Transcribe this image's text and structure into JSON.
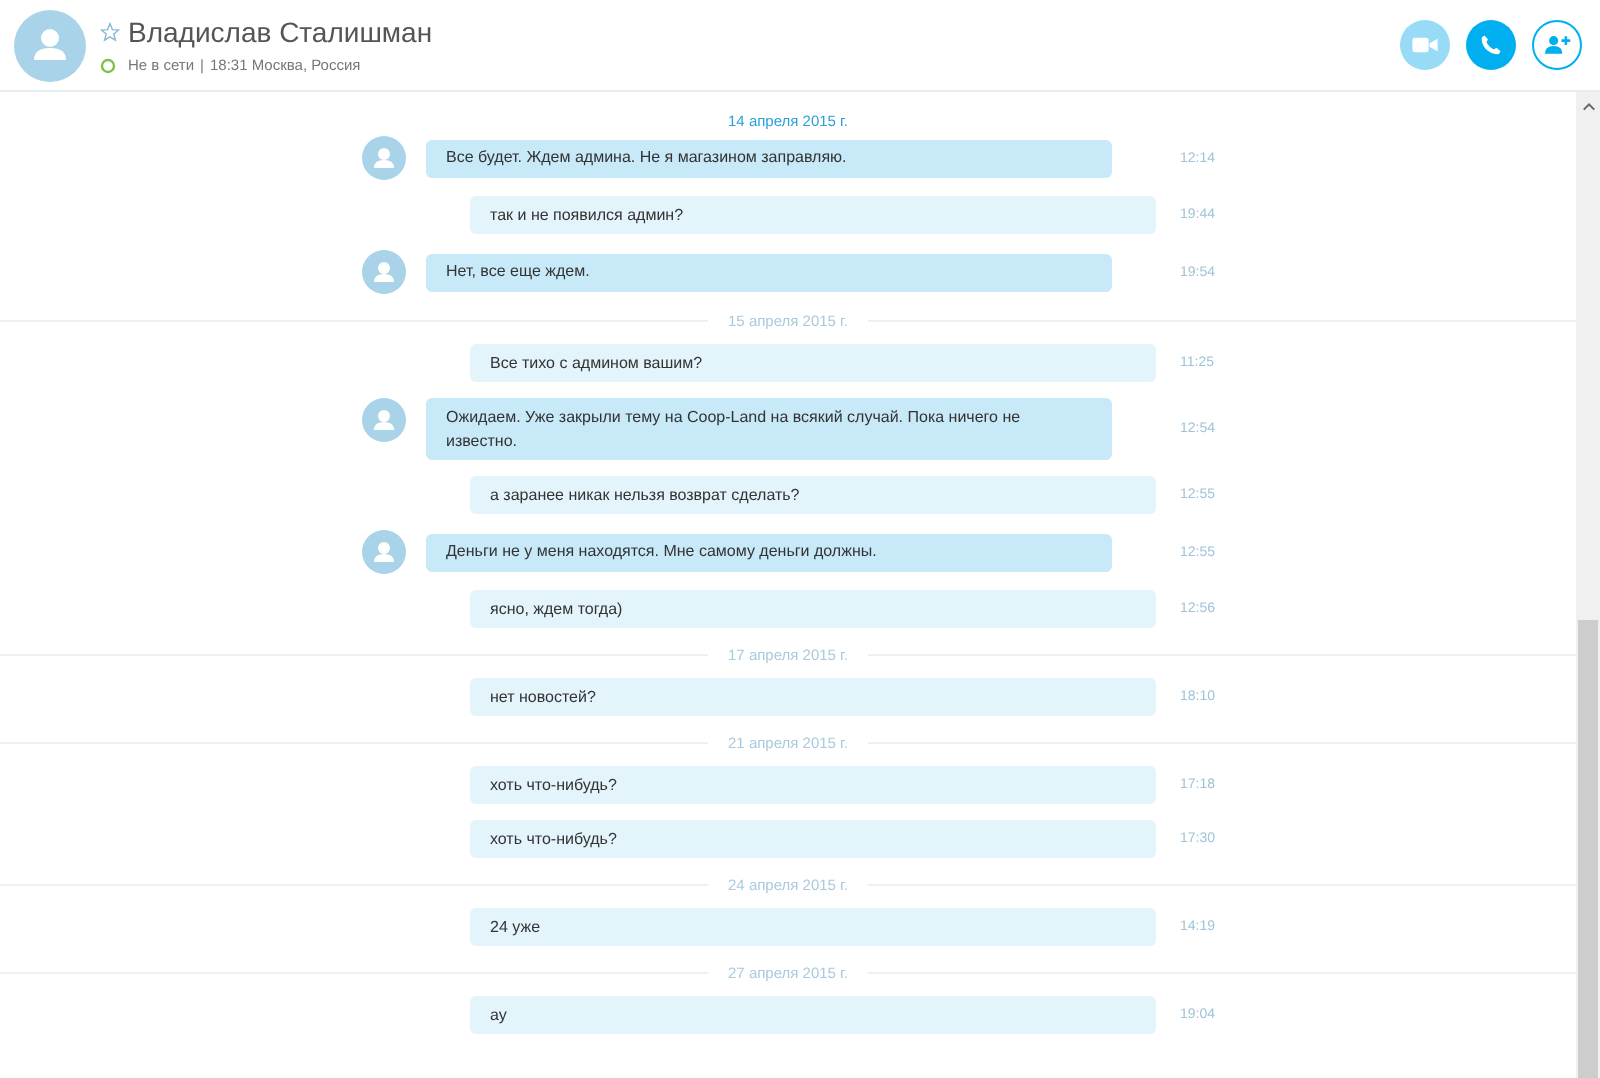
{
  "contact": {
    "name": "Владислав Сталишман",
    "favorite": false,
    "status": "Не в сети",
    "separator": "|",
    "local_time": "18:31 Москва, Россия"
  },
  "items": [
    {
      "kind": "date",
      "text": "14 апреля 2015 г.",
      "current": true
    },
    {
      "kind": "message",
      "incoming": true,
      "text": "Все будет. Ждем админа. Не я магазином заправляю.",
      "time": "12:14"
    },
    {
      "kind": "message",
      "incoming": false,
      "text": "так и не появился админ?",
      "time": "19:44"
    },
    {
      "kind": "message",
      "incoming": true,
      "text": "Нет, все еще ждем.",
      "time": "19:54"
    },
    {
      "kind": "date",
      "text": "15 апреля 2015 г.",
      "current": false
    },
    {
      "kind": "message",
      "incoming": false,
      "text": "Все тихо с админом вашим?",
      "time": "11:25"
    },
    {
      "kind": "message",
      "incoming": true,
      "text": "Ожидаем. Уже закрыли тему на Coop-Land на всякий случай. Пока ничего не известно.",
      "time": "12:54"
    },
    {
      "kind": "message",
      "incoming": false,
      "text": "а заранее никак нельзя возврат сделать?",
      "time": "12:55"
    },
    {
      "kind": "message",
      "incoming": true,
      "text": "Деньги не у меня находятся. Мне самому деньги должны.",
      "time": "12:55"
    },
    {
      "kind": "message",
      "incoming": false,
      "text": "ясно, ждем тогда)",
      "time": "12:56"
    },
    {
      "kind": "date",
      "text": "17 апреля 2015 г.",
      "current": false
    },
    {
      "kind": "message",
      "incoming": false,
      "text": "нет новостей?",
      "time": "18:10"
    },
    {
      "kind": "date",
      "text": "21 апреля 2015 г.",
      "current": false
    },
    {
      "kind": "message",
      "incoming": false,
      "text": "хоть что-нибудь?",
      "time": "17:18"
    },
    {
      "kind": "message",
      "incoming": false,
      "text": "хоть что-нибудь?",
      "time": "17:30"
    },
    {
      "kind": "date",
      "text": "24 апреля 2015 г.",
      "current": false
    },
    {
      "kind": "message",
      "incoming": false,
      "text": "24 уже",
      "time": "14:19"
    },
    {
      "kind": "date",
      "text": "27 апреля 2015 г.",
      "current": false
    },
    {
      "kind": "message",
      "incoming": false,
      "text": "ау",
      "time": "19:04"
    }
  ]
}
